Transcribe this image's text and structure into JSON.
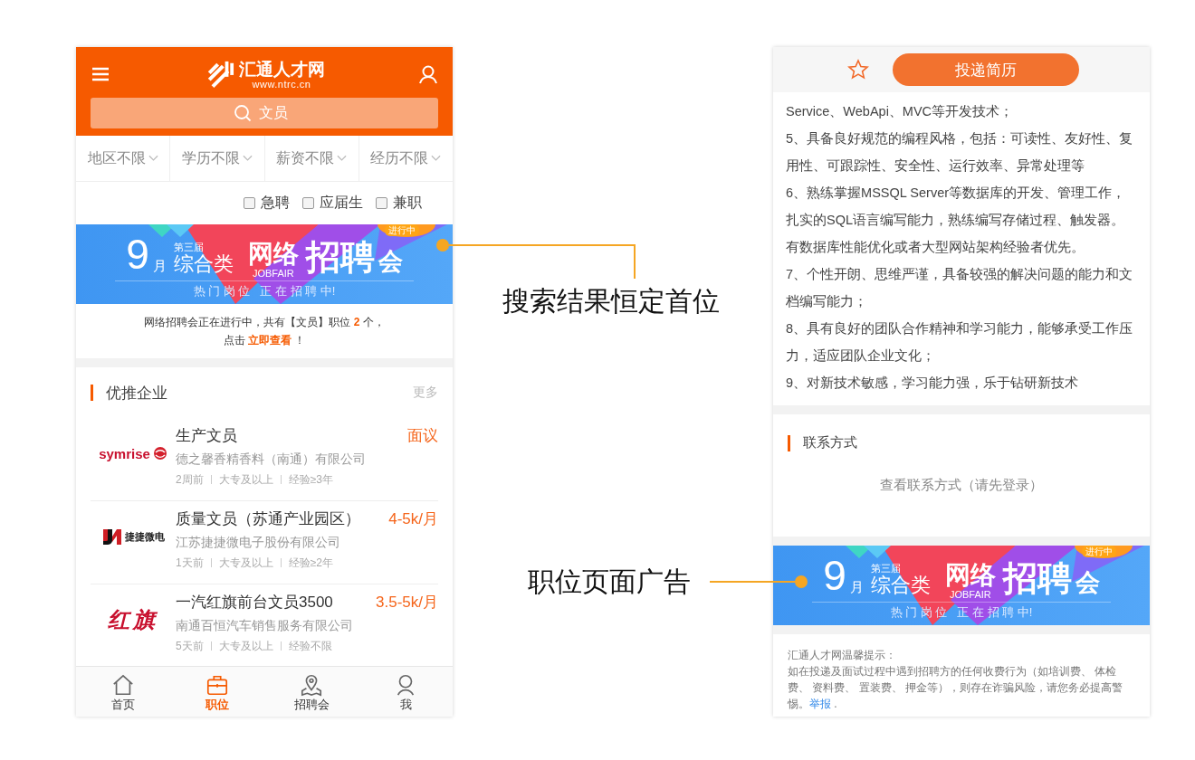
{
  "left_phone": {
    "header": {
      "logo_name": "汇通人才网",
      "logo_url": "www.ntrc.cn"
    },
    "search": {
      "value": "文员"
    },
    "filters": [
      {
        "label": "地区不限"
      },
      {
        "label": "学历不限"
      },
      {
        "label": "薪资不限"
      },
      {
        "label": "经历不限"
      }
    ],
    "options": [
      {
        "label": "急聘",
        "checked": false
      },
      {
        "label": "应届生",
        "checked": false
      },
      {
        "label": "兼职",
        "checked": false
      }
    ],
    "banner": {
      "month": "9",
      "month_unit": "月",
      "edition": "第三届",
      "category": "综合类",
      "title_a": "网络",
      "title_a_en": "JOBFAIR",
      "title_b": "招聘",
      "title_c": "会",
      "badge": "进行中",
      "subtitle": "热 门 岗 位   正 在 招 聘 中!"
    },
    "notice": {
      "text_before": "网络招聘会正在进行中，共有【文员】职位",
      "count": "2",
      "text_after": "个，",
      "click_prefix": "点击",
      "link": "立即查看",
      "suffix": "！"
    },
    "section": {
      "title": "优推企业",
      "more": "更多"
    },
    "jobs": [
      {
        "logo": {
          "kind": "symrise",
          "text": "symrise"
        },
        "title": "生产文员",
        "salary": "面议",
        "company": "德之馨香精香料（南通）有限公司",
        "meta": [
          "2周前",
          "大专及以上",
          "经验≥3年"
        ]
      },
      {
        "logo": {
          "kind": "jiejie",
          "text": "捷捷微电"
        },
        "title": "质量文员（苏通产业园区）",
        "salary": "4-5k/月",
        "company": "江苏捷捷微电子股份有限公司",
        "meta": [
          "1天前",
          "大专及以上",
          "经验≥2年"
        ]
      },
      {
        "logo": {
          "kind": "hongqi",
          "text": "红旗"
        },
        "title": "一汽红旗前台文员3500",
        "salary": "3.5-5k/月",
        "company": "南通百恒汽车销售服务有限公司",
        "meta": [
          "5天前",
          "大专及以上",
          "经验不限"
        ]
      }
    ],
    "tabs": [
      {
        "label": "首页",
        "selected": false
      },
      {
        "label": "职位",
        "selected": true
      },
      {
        "label": "招聘会",
        "selected": false
      },
      {
        "label": "我",
        "selected": false
      }
    ]
  },
  "annotations": [
    {
      "label": "搜索结果恒定首位"
    },
    {
      "label": "职位页面广告"
    }
  ],
  "right_phone": {
    "action_button": "投递简历",
    "requirements": [
      "Service、WebApi、MVC等开发技术；",
      "5、具备良好规范的编程风格，包括：可读性、友好性、复用性、可跟踪性、安全性、运行效率、异常处理等",
      "6、熟练掌握MSSQL Server等数据库的开发、管理工作，扎实的SQL语言编写能力，熟练编写存储过程、触发器。",
      "有数据库性能优化或者大型网站架构经验者优先。",
      "7、个性开朗、思维严谨，具备较强的解决问题的能力和文档编写能力；",
      "8、具有良好的团队合作精神和学习能力，能够承受工作压力，适应团队企业文化；",
      "9、对新技术敏感，学习能力强，乐于钻研新技术"
    ],
    "contact": {
      "title": "联系方式",
      "link": "查看联系方式（请先登录）"
    },
    "banner": {
      "month": "9",
      "month_unit": "月",
      "edition": "第三届",
      "category": "综合类",
      "title_a": "网络",
      "title_a_en": "JOBFAIR",
      "title_b": "招聘",
      "title_c": "会",
      "badge": "进行中",
      "subtitle": "热 门 岗 位   正 在 招 聘 中!"
    },
    "tips": {
      "title": "汇通人才网温馨提示：",
      "body": "如在投递及面试过程中遇到招聘方的任何收费行为（如培训费、 体检费、 资料费、 置装费、 押金等），则存在诈骗风险，请您务必提高警惕。",
      "link": "举报",
      "suffix": " ."
    }
  }
}
